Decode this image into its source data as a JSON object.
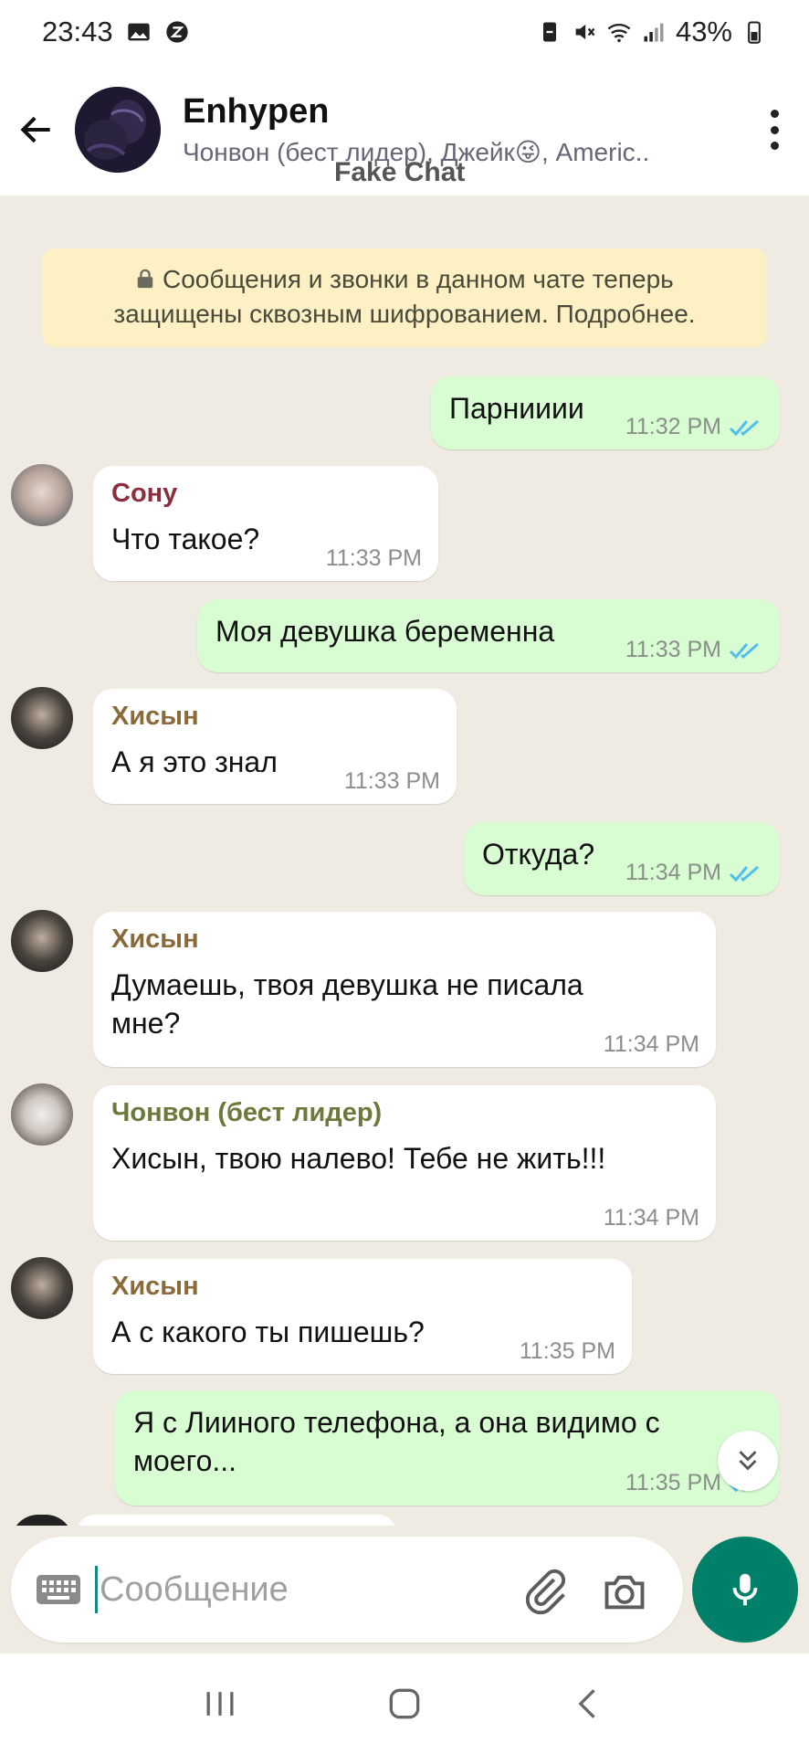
{
  "status_bar": {
    "time": "23:43",
    "battery": "43%",
    "icons": [
      "gallery-icon",
      "app-z-icon",
      "battery-saver-icon",
      "mute-icon",
      "wifi-icon",
      "signal-icon",
      "battery-icon"
    ]
  },
  "header": {
    "title": "Enhypen",
    "subtitle": "Чонвон (бест лидер), Джейк😜, Americ..",
    "watermark": "Fake Chat"
  },
  "encryption_notice": {
    "line1": "Сообщения и звонки в данном чате теперь",
    "line2": "защищены сквозным шифрованием. Подробнее."
  },
  "messages": [
    {
      "direction": "out",
      "text": "Парнииии",
      "time": "11:32 PM",
      "read": true
    },
    {
      "direction": "in",
      "sender": "Сону",
      "sender_color": "#8b2f3f",
      "text": "Что такое?",
      "time": "11:33 PM"
    },
    {
      "direction": "out",
      "text": "Моя девушка беременна",
      "time": "11:33 PM",
      "read": true
    },
    {
      "direction": "in",
      "sender": "Хисын",
      "sender_color": "#8a6a3a",
      "text": "А я это знал",
      "time": "11:33 PM"
    },
    {
      "direction": "out",
      "text": "Откуда?",
      "time": "11:34 PM",
      "read": true
    },
    {
      "direction": "in",
      "sender": "Хисын",
      "sender_color": "#8a6a3a",
      "text_line1": "Думаешь, твоя девушка не писала",
      "text_line2": "мне?",
      "time": "11:34 PM"
    },
    {
      "direction": "in",
      "sender": "Чонвон (бест лидер)",
      "sender_color": "#6b7a3a",
      "text": "Хисын, твою налево! Тебе не жить!!!",
      "time": "11:34 PM"
    },
    {
      "direction": "in",
      "sender": "Хисын",
      "sender_color": "#8a6a3a",
      "text": "А с какого ты пишешь?",
      "time": "11:35 PM"
    },
    {
      "direction": "out",
      "text_line1": "Я с Лииного телефона, а она видимо с",
      "text_line2": "моего...",
      "time": "11:35 PM",
      "read": true
    }
  ],
  "input": {
    "placeholder": "Сообщение"
  },
  "colors": {
    "accent": "#008069",
    "outgoing_bubble": "#d9fdd3",
    "incoming_bubble": "#ffffff",
    "chat_background": "#efeae2",
    "read_ticks": "#53bdeb"
  }
}
